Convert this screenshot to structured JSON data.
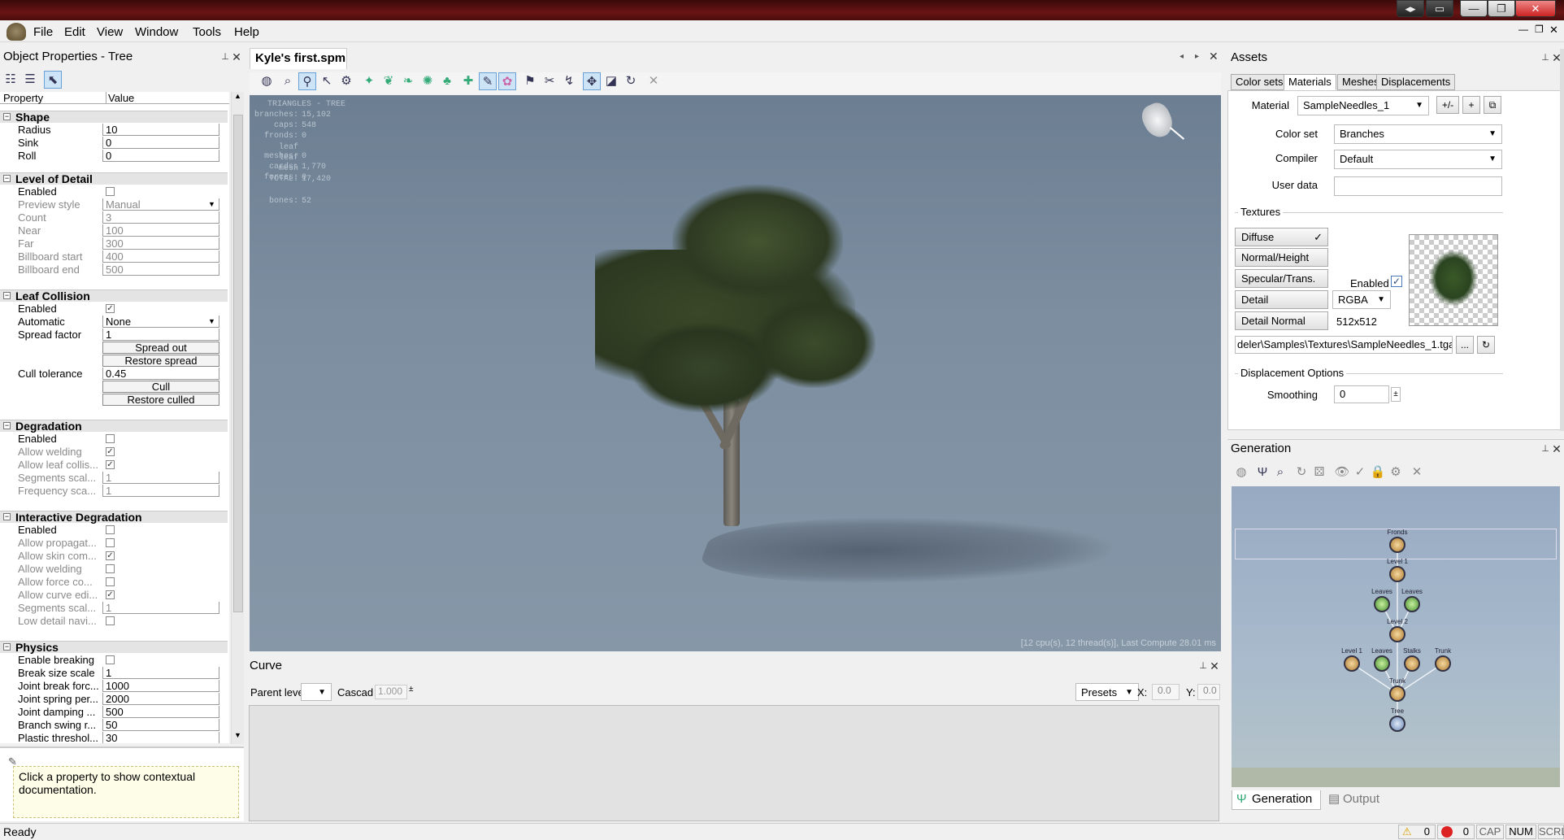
{
  "window": {
    "buttons": [
      "◂▸",
      "▭",
      "—",
      "❐",
      "✕"
    ]
  },
  "menu": [
    "File",
    "Edit",
    "View",
    "Window",
    "Tools",
    "Help"
  ],
  "left_panel": {
    "title": "Object Properties - Tree",
    "col_property": "Property",
    "col_value": "Value",
    "sections": {
      "shape": {
        "title": "Shape",
        "rows": [
          [
            "Radius",
            "10"
          ],
          [
            "Sink",
            "0"
          ],
          [
            "Roll",
            "0"
          ]
        ]
      },
      "lod": {
        "title": "Level of Detail",
        "rows": [
          [
            "Enabled",
            ""
          ],
          [
            "Preview style",
            "Manual"
          ],
          [
            "Count",
            "3"
          ],
          [
            "Near",
            "100"
          ],
          [
            "Far",
            "300"
          ],
          [
            "Billboard start",
            "400"
          ],
          [
            "Billboard end",
            "500"
          ]
        ]
      },
      "leafcol": {
        "title": "Leaf Collision",
        "rows": [
          [
            "Enabled",
            "✓"
          ],
          [
            "Automatic",
            "None"
          ],
          [
            "Spread factor",
            "1"
          ]
        ],
        "btn_spread_out": "Spread out",
        "btn_restore_spread": "Restore spread",
        "cull_label": "Cull tolerance",
        "cull_value": "0.45",
        "btn_cull": "Cull",
        "btn_restore_culled": "Restore culled"
      },
      "degradation": {
        "title": "Degradation",
        "rows": [
          [
            "Enabled",
            ""
          ],
          [
            "Allow welding",
            "✓"
          ],
          [
            "Allow leaf collis...",
            "✓"
          ],
          [
            "Segments scal...",
            "1"
          ],
          [
            "Frequency sca...",
            "1"
          ]
        ]
      },
      "interactive": {
        "title": "Interactive Degradation",
        "rows": [
          [
            "Enabled",
            ""
          ],
          [
            "Allow propagat...",
            ""
          ],
          [
            "Allow skin com...",
            "✓"
          ],
          [
            "Allow welding",
            ""
          ],
          [
            "Allow force co...",
            ""
          ],
          [
            "Allow curve edi...",
            "✓"
          ],
          [
            "Segments scal...",
            "1"
          ],
          [
            "Low detail navi...",
            ""
          ]
        ]
      },
      "physics": {
        "title": "Physics",
        "rows": [
          [
            "Enable breaking",
            ""
          ],
          [
            "Break size scale",
            "1"
          ],
          [
            "Joint break forc...",
            "1000"
          ],
          [
            "Joint spring per...",
            "2000"
          ],
          [
            "Joint damping ...",
            "500"
          ],
          [
            "Branch swing r...",
            "50"
          ],
          [
            "Plastic threshol...",
            "30"
          ]
        ]
      }
    },
    "help_text": "Click a property to show contextual documentation."
  },
  "document": {
    "tab_title": "Kyle's first.spm",
    "stats": {
      "header": "TRIANGLES - TREE",
      "lines": [
        [
          "branches:",
          "15,102"
        ],
        [
          "caps:",
          "548"
        ],
        [
          "fronds:",
          "0"
        ],
        [
          "leaf meshes:",
          "0"
        ],
        [
          "leaf cards:",
          "1,770"
        ],
        [
          "mesh forces:",
          "0"
        ],
        [
          "TOTAL:",
          "17,420"
        ],
        [
          "",
          ""
        ],
        [
          "bones:",
          "52"
        ]
      ]
    },
    "compute_info": "[12 cpu(s), 12 thread(s)], Last Compute 28.01 ms"
  },
  "curve": {
    "title": "Curve",
    "parent_label": "Parent leve",
    "cascade_label": "Cascad",
    "cascade_value": "1.000",
    "presets_label": "Presets",
    "x_label": "X:",
    "x_value": "0.0",
    "y_label": "Y:",
    "y_value": "0.0"
  },
  "assets": {
    "title": "Assets",
    "tabs": [
      "Color sets",
      "Materials",
      "Meshes",
      "Displacements"
    ],
    "material_label": "Material",
    "material_value": "SampleNeedles_1",
    "btn_plusminus": "+/-",
    "btn_plus": "+",
    "colorset_label": "Color set",
    "colorset_value": "Branches",
    "compiler_label": "Compiler",
    "compiler_value": "Default",
    "userdata_label": "User data",
    "userdata_value": "",
    "textures_label": "Textures",
    "texture_buttons": [
      "Diffuse",
      "Normal/Height",
      "Specular/Trans.",
      "Detail",
      "Detail Normal"
    ],
    "enabled_label": "Enabled",
    "format_value": "RGBA",
    "size_value": "512x512",
    "path_value": "deler\\Samples\\Textures\\SampleNeedles_1.tga",
    "browse_label": "...",
    "displacement_label": "Displacement Options",
    "smoothing_label": "Smoothing",
    "smoothing_value": "0"
  },
  "generation": {
    "title": "Generation",
    "nodes": [
      "Fronds",
      "Level 1",
      "Leaves",
      "Leaves",
      "Level 2",
      "Level 1",
      "Leaves",
      "Stalks",
      "Trunk",
      "Trunk",
      "Tree"
    ],
    "bottom_tabs": [
      "Generation",
      "Output"
    ]
  },
  "status": {
    "text": "Ready",
    "warnings": "0",
    "errors": "0",
    "cap": "CAP",
    "num": "NUM",
    "scrl": "SCRL"
  }
}
